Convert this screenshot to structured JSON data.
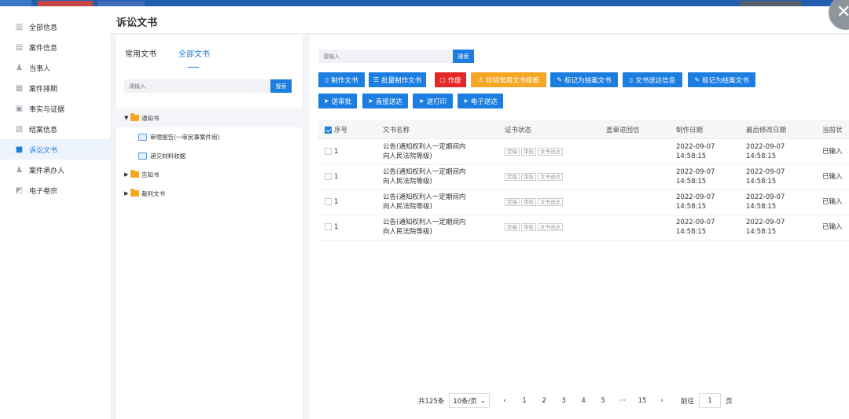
{
  "page": {
    "title": "诉讼文书"
  },
  "nav": [
    {
      "label": "全部信息",
      "icon": "book-icon"
    },
    {
      "label": "案件信息",
      "icon": "case-icon"
    },
    {
      "label": "当事人",
      "icon": "person-icon"
    },
    {
      "label": "案件排期",
      "icon": "calendar-icon"
    },
    {
      "label": "事实与证据",
      "icon": "evidence-icon"
    },
    {
      "label": "结案信息",
      "icon": "file-icon"
    },
    {
      "label": "诉讼文书",
      "icon": "folder-icon"
    },
    {
      "label": "案件承办人",
      "icon": "user-icon"
    },
    {
      "label": "电子卷宗",
      "icon": "archive-icon"
    }
  ],
  "mid": {
    "tabs": [
      "常用文书",
      "全部文书"
    ],
    "search_placeholder": "请输入",
    "search_button": "搜索",
    "tree": {
      "n0": "通知书",
      "n0_c0": "审理报告(一审民事案件用)",
      "n0_c1": "递交材料收据",
      "n1": "告知书",
      "n2": "裁判文书"
    }
  },
  "main": {
    "search_placeholder": "请输入",
    "search_button": "搜索",
    "buttons": [
      "制作文书",
      "批量制作文书",
      "作废",
      "移除常用文书模板",
      "标记为结案文书",
      "文书送达信息",
      "标记为结案文书",
      "送审批",
      "直接送达",
      "送打印",
      "电子送达"
    ],
    "columns": [
      "序号",
      "文书名称",
      "证书状态",
      "盖章退回信",
      "制作日期",
      "最后修改日期",
      "当前状"
    ],
    "tags": [
      "定稿",
      "审批",
      "文书送达"
    ],
    "rows": [
      {
        "no": "1",
        "name1": "公告(通知权利人一定期间内",
        "name2": "向人民法院等级)",
        "made1": "2022-09-07",
        "made2": "14:58:15",
        "mod1": "2022-09-07",
        "mod2": "14:58:15",
        "status": "已输入"
      },
      {
        "no": "1",
        "name1": "公告(通知权利人一定期间内",
        "name2": "向人民法院等级)",
        "made1": "2022-09-07",
        "made2": "14:58:15",
        "mod1": "2022-09-07",
        "mod2": "14:58:15",
        "status": "已输入"
      },
      {
        "no": "1",
        "name1": "公告(通知权利人一定期间内",
        "name2": "向人民法院等级)",
        "made1": "2022-09-07",
        "made2": "14:58:15",
        "mod1": "2022-09-07",
        "mod2": "14:58:15",
        "status": "已输入"
      },
      {
        "no": "1",
        "name1": "公告(通知权利人一定期间内",
        "name2": "向人民法院等级)",
        "made1": "2022-09-07",
        "made2": "14:58:15",
        "mod1": "2022-09-07",
        "mod2": "14:58:15",
        "status": "已输入"
      }
    ],
    "pager": {
      "total": "共125条",
      "page_size": "10条/页",
      "pages": [
        "1",
        "2",
        "3",
        "4",
        "5",
        "···",
        "15"
      ],
      "goto_label": "前往",
      "goto_value": "1",
      "page_unit": "页"
    }
  },
  "colors": {
    "accent": "#1c7ee0",
    "danger": "#e52626",
    "warning": "#f5a623"
  }
}
